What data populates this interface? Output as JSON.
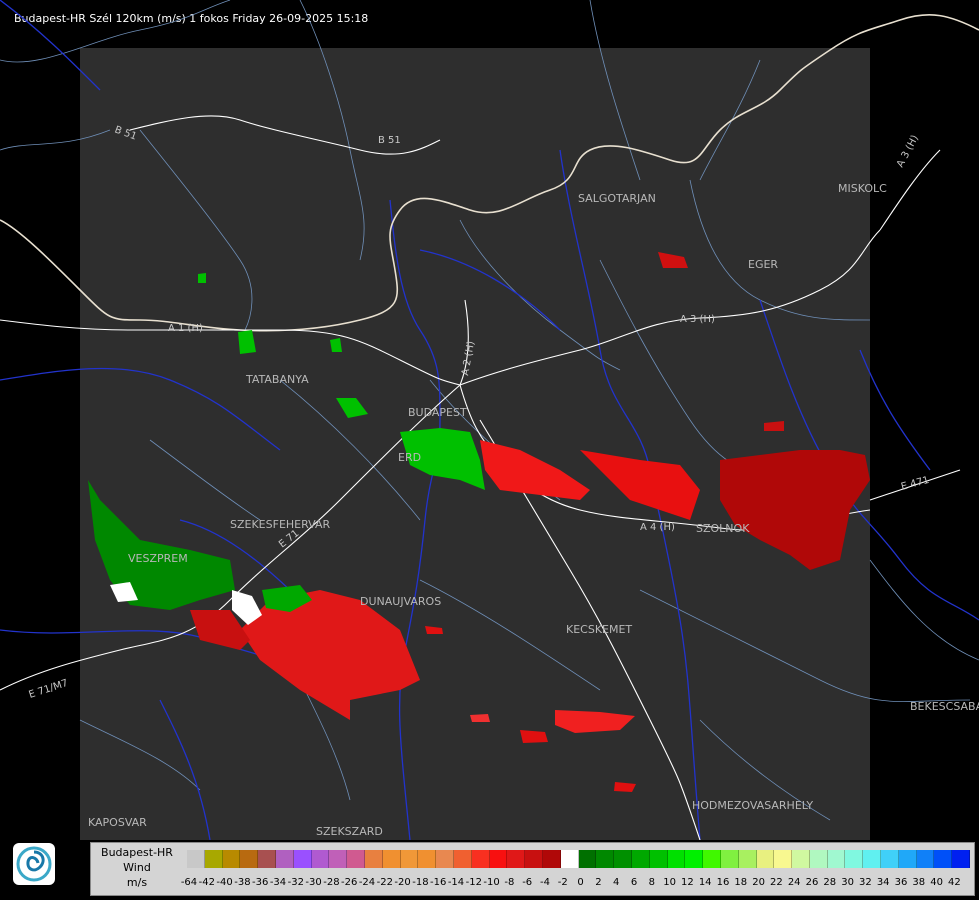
{
  "header": {
    "title": "Budapest-HR Szél 120km (m/s) 1 fokos Friday 26-09-2025 15:18"
  },
  "map": {
    "panel_color": "#2e2e2e",
    "river_color": "#2233cc",
    "border_color": "#e8e0d0",
    "road_color": "#ffffff",
    "county_color": "#6f8fb8",
    "cities": [
      {
        "name": "SALGOTARJAN"
      },
      {
        "name": "EGER"
      },
      {
        "name": "MISKOLC"
      },
      {
        "name": "TATABANYA"
      },
      {
        "name": "BUDAPEST"
      },
      {
        "name": "ERD"
      },
      {
        "name": "SZEKESFEHERVAR"
      },
      {
        "name": "VESZPREM"
      },
      {
        "name": "DUNAUJVAROS"
      },
      {
        "name": "KECSKEMET"
      },
      {
        "name": "SZOLNOK"
      },
      {
        "name": "BEKESCSABA"
      },
      {
        "name": "HODMEZOVASARHELY"
      },
      {
        "name": "KAPOSVAR"
      },
      {
        "name": "SZEKSZARD"
      }
    ],
    "roads": [
      {
        "name": "B 51"
      },
      {
        "name": "B 51"
      },
      {
        "name": "A 3 (H)"
      },
      {
        "name": "A 3 (H)"
      },
      {
        "name": "A 1 (H)"
      },
      {
        "name": "A 2 (H)"
      },
      {
        "name": "A 4 (H)"
      },
      {
        "name": "E 471"
      },
      {
        "name": "E 71"
      },
      {
        "name": "E 71/M7"
      }
    ]
  },
  "legend": {
    "title_line1": "Budapest-HR",
    "title_line2": "Wind",
    "title_line3": "m/s",
    "colors": [
      "#c8c8c8",
      "#a8a800",
      "#b88a00",
      "#b86a10",
      "#a85050",
      "#b060c0",
      "#9a50ff",
      "#b05ad0",
      "#c060b8",
      "#d05a90",
      "#e88040",
      "#f09030",
      "#f09838",
      "#f09030",
      "#e88850",
      "#f06030",
      "#f83020",
      "#f81010",
      "#e01818",
      "#c81010",
      "#b00808",
      "#ffffff",
      "#007000",
      "#008800",
      "#009000",
      "#00a800",
      "#00c000",
      "#00e000",
      "#00f000",
      "#40f800",
      "#80f040",
      "#a8f060",
      "#e8f080",
      "#f8f890",
      "#d0f8a0",
      "#b0f8c0",
      "#a0f8d0",
      "#80f8e0",
      "#60f0f0",
      "#40d0f8",
      "#20a8f8",
      "#1080f8",
      "#0050f8",
      "#0020f0"
    ],
    "ticks": [
      "-64",
      "-42",
      "-40",
      "-38",
      "-36",
      "-34",
      "-32",
      "-30",
      "-28",
      "-26",
      "-24",
      "-22",
      "-20",
      "-18",
      "-16",
      "-14",
      "-12",
      "-10",
      "-8",
      "-6",
      "-4",
      "-2",
      "0",
      "2",
      "4",
      "6",
      "8",
      "10",
      "12",
      "14",
      "16",
      "18",
      "20",
      "22",
      "24",
      "26",
      "28",
      "30",
      "32",
      "34",
      "36",
      "38",
      "40",
      "42"
    ]
  }
}
